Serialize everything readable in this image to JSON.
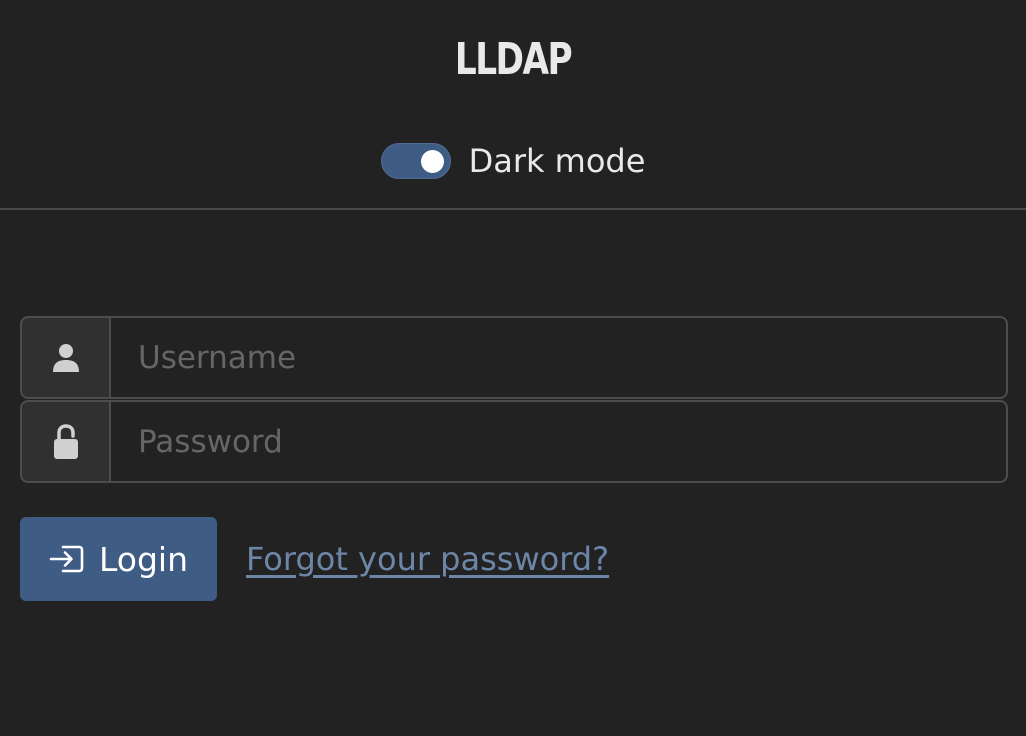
{
  "header": {
    "app_title": "LLDAP",
    "dark_mode": {
      "label": "Dark mode",
      "checked": true
    }
  },
  "login_form": {
    "username": {
      "value": "",
      "placeholder": "Username",
      "icon": "person-icon"
    },
    "password": {
      "value": "",
      "placeholder": "Password",
      "icon": "lock-icon"
    },
    "login_button": {
      "label": "Login",
      "icon": "login-arrow-icon"
    },
    "forgot_link": "Forgot your password?"
  },
  "colors": {
    "background": "#222222",
    "accent": "#3f5c85",
    "link": "#6d86a8",
    "border": "#4c4c4c",
    "addon_background": "#303030"
  }
}
